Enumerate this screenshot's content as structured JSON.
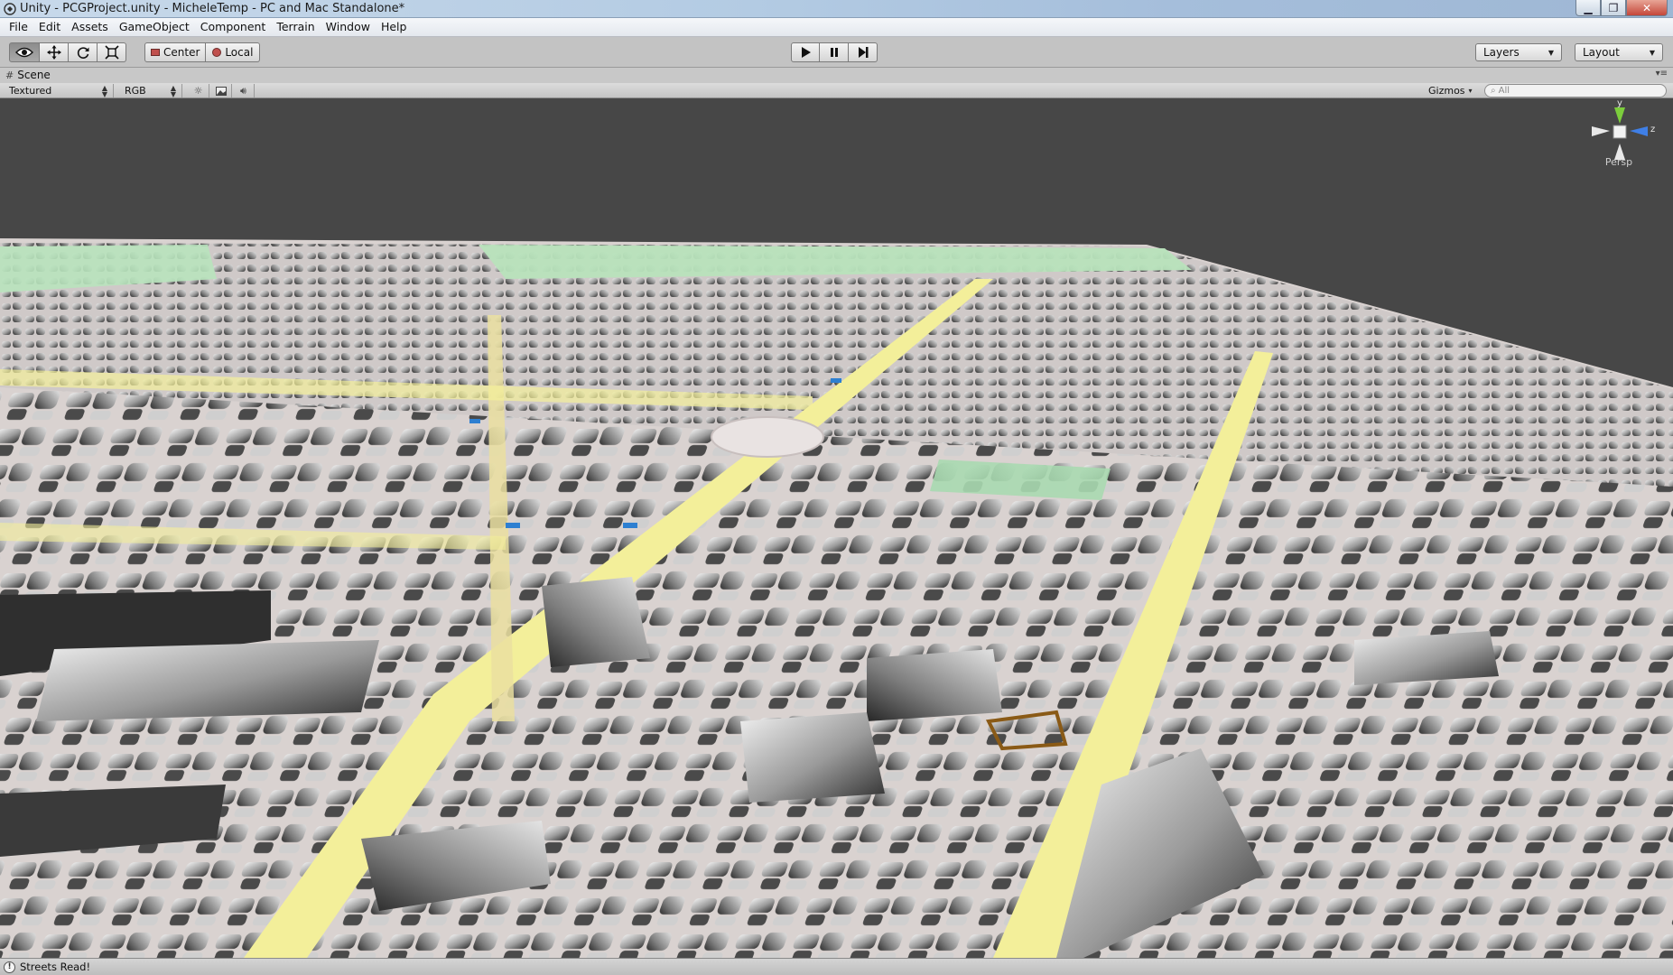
{
  "window": {
    "title": "Unity - PCGProject.unity - MicheleTemp - PC and Mac Standalone*",
    "minimize_glyph": "▁",
    "maximize_glyph": "❐",
    "close_glyph": "✕"
  },
  "menu": {
    "items": [
      "File",
      "Edit",
      "Assets",
      "GameObject",
      "Component",
      "Terrain",
      "Window",
      "Help"
    ]
  },
  "toolbar": {
    "tools": [
      {
        "name": "view-tool",
        "icon": "eye-icon",
        "active": true
      },
      {
        "name": "move-tool",
        "icon": "move-arrows-icon",
        "active": false
      },
      {
        "name": "rotate-tool",
        "icon": "rotate-icon",
        "active": false
      },
      {
        "name": "scale-tool",
        "icon": "scale-icon",
        "active": false
      }
    ],
    "pivot_mode": "Center",
    "pivot_rotation": "Local",
    "playback": [
      {
        "name": "play",
        "icon": "play-icon"
      },
      {
        "name": "pause",
        "icon": "pause-icon"
      },
      {
        "name": "step",
        "icon": "step-icon"
      }
    ],
    "layers_label": "Layers",
    "layout_label": "Layout"
  },
  "scene": {
    "tab_label": "Scene",
    "render_mode": "Textured",
    "color_mode": "RGB",
    "gizmos_label": "Gizmos",
    "search_placeholder": "All",
    "toggles": [
      {
        "name": "lighting-toggle",
        "icon": "sun-icon"
      },
      {
        "name": "effects-toggle",
        "icon": "image-icon"
      },
      {
        "name": "audio-toggle",
        "icon": "speaker-icon"
      }
    ]
  },
  "gizmo": {
    "projection": "Persp",
    "axis_y": "y",
    "axis_z": "z",
    "colors": {
      "y": "#7ccd3c",
      "z": "#3f7fe6",
      "x": "#e0e0e0"
    }
  },
  "status": {
    "message": "Streets Read!"
  },
  "palette": {
    "sky": "#474747",
    "ground": "#d9d2d0",
    "park": "#b8e3bc",
    "main_road": "#f3ef9a",
    "building_light": "#eeeeee",
    "building_dark": "#3a3a3a"
  }
}
